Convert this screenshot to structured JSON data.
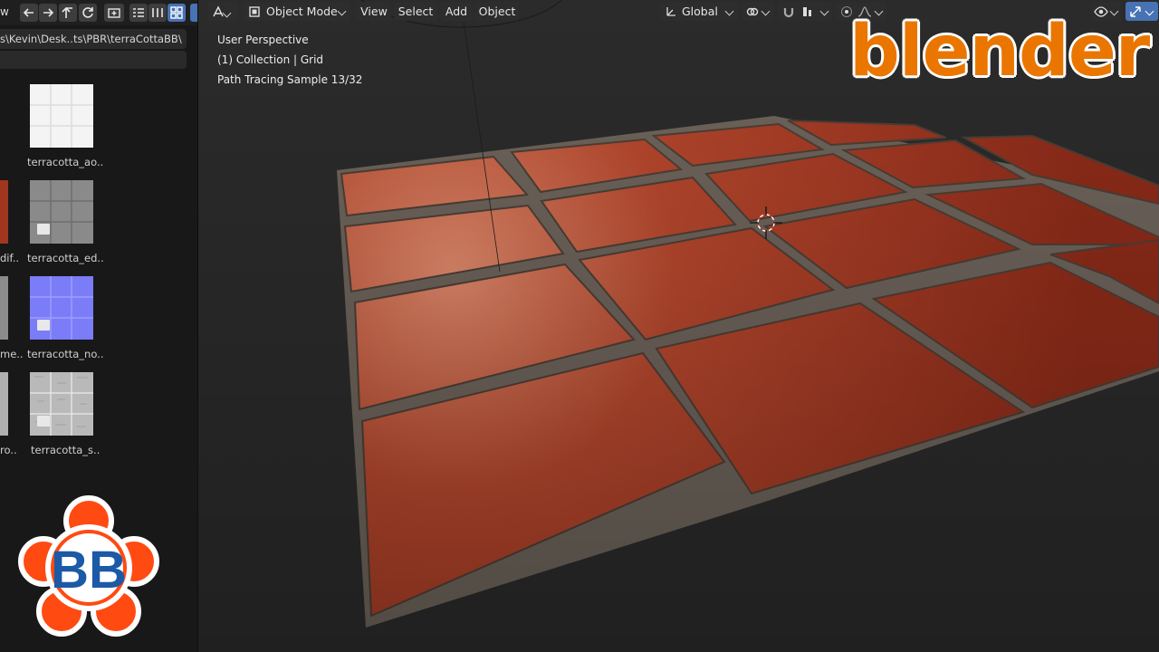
{
  "file_browser": {
    "header_partial_label": "w",
    "path": "s\\Kevin\\Desk..ts\\PBR\\terraCottaBB\\",
    "thumbnails": [
      {
        "label": "terracotta_ao..",
        "kind": "ao"
      },
      {
        "label": "terracotta_ed..",
        "kind": "edge"
      },
      {
        "label": "terracotta_no..",
        "kind": "normal"
      },
      {
        "label": "terracotta_s..",
        "kind": "specular"
      }
    ],
    "cut_labels": [
      "dif..",
      "me..",
      "ro.."
    ]
  },
  "viewport": {
    "header": {
      "mode": "Object Mode",
      "menus": [
        "View",
        "Select",
        "Add",
        "Object"
      ],
      "orientation": "Global"
    },
    "overlay": {
      "line1": "User Perspective",
      "line2": "(1) Collection | Grid",
      "line3": "Path Tracing Sample 13/32"
    }
  },
  "branding": {
    "logo_text": "blender",
    "logo_color": "#ea7600",
    "badge_text": "BB",
    "badge_flower_color": "#ff4a12",
    "badge_letter_color": "#1b5aa6"
  },
  "colors": {
    "tile": "#b9462c",
    "grout": "#6a6158"
  }
}
